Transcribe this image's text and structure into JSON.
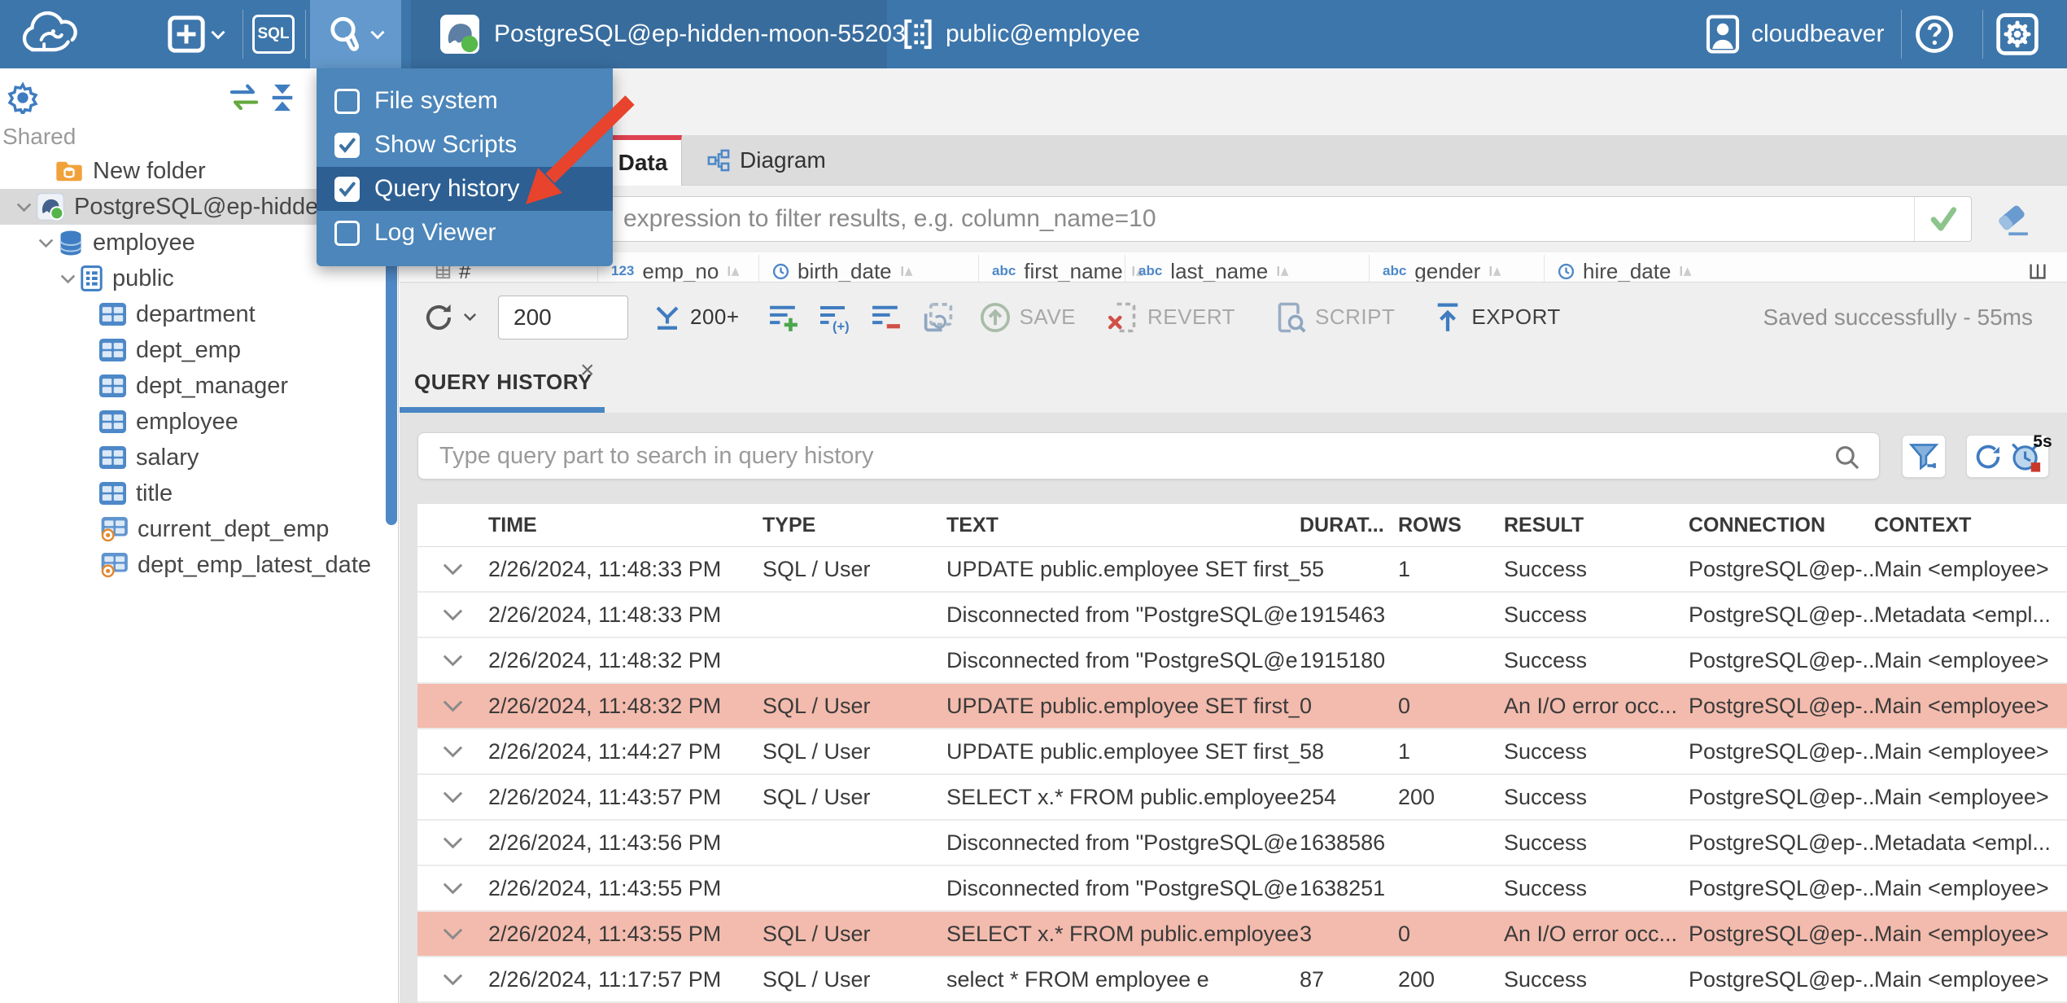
{
  "topbar": {
    "app": "CloudBeaver",
    "sql_label": "SQL",
    "connection": "PostgreSQL@ep-hidden-moon-55203",
    "schema": "public@employee",
    "user": "cloudbeaver"
  },
  "tools_menu": {
    "items": [
      {
        "label": "File system",
        "checked": false,
        "highlighted": false
      },
      {
        "label": "Show Scripts",
        "checked": true,
        "highlighted": false
      },
      {
        "label": "Query history",
        "checked": true,
        "highlighted": true
      },
      {
        "label": "Log Viewer",
        "checked": false,
        "highlighted": false
      }
    ]
  },
  "sidebar": {
    "section": "Shared",
    "tree": [
      {
        "label": "New folder",
        "icon": "folder",
        "level": 1,
        "chevron": false,
        "selected": false
      },
      {
        "label": "PostgreSQL@ep-hidden-",
        "icon": "postgres",
        "level": 0,
        "chevron": true,
        "selected": true
      },
      {
        "label": "employee",
        "icon": "database",
        "level": 1,
        "chevron": true,
        "selected": false
      },
      {
        "label": "public",
        "icon": "schema",
        "level": 2,
        "chevron": true,
        "selected": false
      },
      {
        "label": "department",
        "icon": "table",
        "level": 3,
        "chevron": false,
        "selected": false
      },
      {
        "label": "dept_emp",
        "icon": "table",
        "level": 3,
        "chevron": false,
        "selected": false
      },
      {
        "label": "dept_manager",
        "icon": "table",
        "level": 3,
        "chevron": false,
        "selected": false
      },
      {
        "label": "employee",
        "icon": "table",
        "level": 3,
        "chevron": false,
        "selected": false
      },
      {
        "label": "salary",
        "icon": "table",
        "level": 3,
        "chevron": false,
        "selected": false
      },
      {
        "label": "title",
        "icon": "table",
        "level": 3,
        "chevron": false,
        "selected": false
      },
      {
        "label": "current_dept_emp",
        "icon": "view",
        "level": 3,
        "chevron": false,
        "selected": false
      },
      {
        "label": "dept_emp_latest_date",
        "icon": "view",
        "level": 3,
        "chevron": false,
        "selected": false
      }
    ]
  },
  "object_tabs": {
    "data": "Data",
    "diagram": "Diagram"
  },
  "filter": {
    "placeholder": "expression to filter results, e.g. column_name=10"
  },
  "grid_header": {
    "row_marker": "#",
    "columns": [
      {
        "type": "123",
        "label": "emp_no"
      },
      {
        "type": "clock",
        "label": "birth_date"
      },
      {
        "type": "abc",
        "label": "first_name"
      },
      {
        "type": "abc",
        "label": "last_name"
      },
      {
        "type": "abc",
        "label": "gender"
      },
      {
        "type": "clock",
        "label": "hire_date"
      }
    ]
  },
  "toolbar": {
    "row_limit": "200",
    "fetch_label": "200+",
    "save": "SAVE",
    "revert": "REVERT",
    "script": "SCRIPT",
    "export": "EXPORT",
    "status": "Saved successfully - 55ms"
  },
  "history_panel": {
    "tab": "QUERY HISTORY",
    "close": "×",
    "search_placeholder": "Type query part to search in query history",
    "refresh_badge": "5s",
    "table": {
      "columns": [
        "TIME",
        "TYPE",
        "TEXT",
        "DURAT...",
        "ROWS",
        "RESULT",
        "CONNECTION",
        "CONTEXT"
      ],
      "rows": [
        {
          "time": "2/26/2024, 11:48:33 PM",
          "type": "SQL / User",
          "text": "UPDATE public.employee SET first_...",
          "duration": "55",
          "rows": "1",
          "result": "Success",
          "connection": "PostgreSQL@ep-...",
          "context": "Main <employee>",
          "error": false
        },
        {
          "time": "2/26/2024, 11:48:33 PM",
          "type": "",
          "text": "Disconnected from \"PostgreSQL@e...",
          "duration": "1915463",
          "rows": "",
          "result": "Success",
          "connection": "PostgreSQL@ep-...",
          "context": "Metadata <empl...",
          "error": false
        },
        {
          "time": "2/26/2024, 11:48:32 PM",
          "type": "",
          "text": "Disconnected from \"PostgreSQL@e...",
          "duration": "1915180",
          "rows": "",
          "result": "Success",
          "connection": "PostgreSQL@ep-...",
          "context": "Main <employee>",
          "error": false
        },
        {
          "time": "2/26/2024, 11:48:32 PM",
          "type": "SQL / User",
          "text": "UPDATE public.employee SET first_...",
          "duration": "0",
          "rows": "0",
          "result": "An I/O error occ...",
          "connection": "PostgreSQL@ep-...",
          "context": "Main <employee>",
          "error": true
        },
        {
          "time": "2/26/2024, 11:44:27 PM",
          "type": "SQL / User",
          "text": "UPDATE public.employee SET first_...",
          "duration": "58",
          "rows": "1",
          "result": "Success",
          "connection": "PostgreSQL@ep-...",
          "context": "Main <employee>",
          "error": false
        },
        {
          "time": "2/26/2024, 11:43:57 PM",
          "type": "SQL / User",
          "text": "SELECT x.* FROM public.employee x",
          "duration": "254",
          "rows": "200",
          "result": "Success",
          "connection": "PostgreSQL@ep-...",
          "context": "Main <employee>",
          "error": false
        },
        {
          "time": "2/26/2024, 11:43:56 PM",
          "type": "",
          "text": "Disconnected from \"PostgreSQL@e...",
          "duration": "1638586",
          "rows": "",
          "result": "Success",
          "connection": "PostgreSQL@ep-...",
          "context": "Metadata <empl...",
          "error": false
        },
        {
          "time": "2/26/2024, 11:43:55 PM",
          "type": "",
          "text": "Disconnected from \"PostgreSQL@e...",
          "duration": "1638251",
          "rows": "",
          "result": "Success",
          "connection": "PostgreSQL@ep-...",
          "context": "Main <employee>",
          "error": false
        },
        {
          "time": "2/26/2024, 11:43:55 PM",
          "type": "SQL / User",
          "text": "SELECT x.* FROM public.employee x",
          "duration": "3",
          "rows": "0",
          "result": "An I/O error occ...",
          "connection": "PostgreSQL@ep-...",
          "context": "Main <employee>",
          "error": true
        },
        {
          "time": "2/26/2024, 11:17:57 PM",
          "type": "SQL / User",
          "text": "select * FROM employee e",
          "duration": "87",
          "rows": "200",
          "result": "Success",
          "connection": "PostgreSQL@ep-...",
          "context": "Main <employee>",
          "error": false
        }
      ]
    }
  }
}
